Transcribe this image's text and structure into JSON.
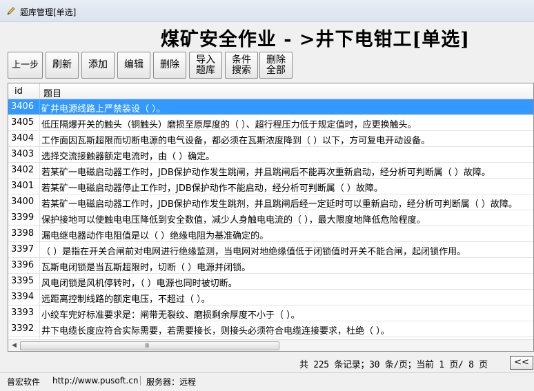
{
  "window": {
    "title": "题库管理[单选]"
  },
  "heading": "煤矿安全作业 - >井下电钳工[单选]",
  "toolbar": {
    "back": "上一步",
    "refresh": "刷新",
    "add": "添加",
    "edit": "编辑",
    "delete": "删除",
    "import": "导入题库",
    "search": "条件搜索",
    "delete_all": "删除全部"
  },
  "grid": {
    "columns": [
      "id",
      "题目"
    ],
    "rows": [
      {
        "id": "3406",
        "text": "矿井电源线路上严禁装设（ ）。"
      },
      {
        "id": "3405",
        "text": "低压隔爆开关的触头（铜触头）磨损至原厚度的（ ）、超行程压力低于规定值时，应更换触头。"
      },
      {
        "id": "3404",
        "text": "工作面因瓦斯超限而切断电源的电气设备，都必须在瓦斯浓度降到（ ）以下，方可复电开动设备。"
      },
      {
        "id": "3403",
        "text": "选择交流接触器额定电流时，由（ ）确定。"
      },
      {
        "id": "3402",
        "text": "若某矿一电磁启动器工作时，JDB保护动作发生跳闸，并且跳闸后不能再次重新启动，经分析可判断属（ ）故障。"
      },
      {
        "id": "3401",
        "text": "若某矿一电磁启动器停止工作时，JDB保护动作不能启动，经分析可判断属（ ）故障。"
      },
      {
        "id": "3400",
        "text": "若某矿一电磁启动器工作时，JDB保护动作发生跳剂，并且跳闸后经一定延时可以重新启动，经分析可判断属（ ）故障。"
      },
      {
        "id": "3399",
        "text": "保护接地可以使触电电压降低到安全数值，减少人身触电电流的（ ），最大限度地降低危险程度。"
      },
      {
        "id": "3398",
        "text": "漏电继电器动作电阻值是以（ ）绝缘电阻为基准确定的。"
      },
      {
        "id": "3397",
        "text": "（ ）是指在开关合闸前对电网进行绝缘监测，当电网对地绝缘值低于闭锁值时开关不能合闸，起闭锁作用。"
      },
      {
        "id": "3396",
        "text": "瓦斯电闭锁是当瓦斯超限时，切断（ ）电源并闭锁。"
      },
      {
        "id": "3395",
        "text": "风电闭锁是风机停转时，（ ）电源也同时被切断。"
      },
      {
        "id": "3394",
        "text": "远距离控制线路的额定电压，不超过（ ）。"
      },
      {
        "id": "3393",
        "text": "小绞车完好标准要求是：闸带无裂纹、磨损剩余厚度不小于（ ）。"
      },
      {
        "id": "3392",
        "text": "井下电缆长度应符合实际需要，若需要接长，则接头必须符合电缆连接要求，杜绝（ ）。"
      },
      {
        "id": "",
        "text": ""
      }
    ],
    "selected_index": 0
  },
  "pager": {
    "summary": "共 225 条记录；30 条/页；当前 1 页/ 8 页",
    "prev": "<<"
  },
  "status": {
    "company": "普宏软件",
    "url": "http://www.pusoft.cn",
    "server": "服务器：远程"
  },
  "colors": {
    "selection": "#3399ff",
    "background": "#f0f0f0"
  }
}
